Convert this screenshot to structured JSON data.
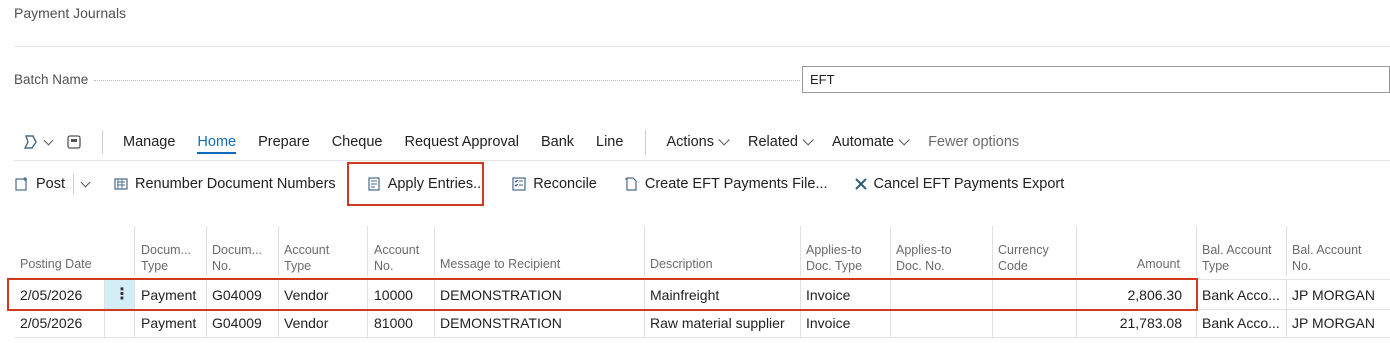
{
  "page": {
    "title": "Payment Journals"
  },
  "batch": {
    "label": "Batch Name",
    "value": "EFT"
  },
  "nav": {
    "tabs": [
      "Manage",
      "Home",
      "Prepare",
      "Cheque",
      "Request Approval",
      "Bank",
      "Line"
    ],
    "active_tab": "Home",
    "menus": [
      "Actions",
      "Related",
      "Automate"
    ],
    "fewer": "Fewer options"
  },
  "actions": {
    "post": "Post",
    "renumber": "Renumber Document Numbers",
    "apply": "Apply Entries...",
    "reconcile": "Reconcile",
    "create_eft": "Create EFT Payments File...",
    "cancel_eft": "Cancel EFT Payments Export"
  },
  "table": {
    "headers": {
      "posting_date": "Posting Date",
      "doc_type_1": "Docum...",
      "doc_type_2": "Type",
      "doc_no_1": "Docum...",
      "doc_no_2": "No.",
      "acc_type_1": "Account",
      "acc_type_2": "Type",
      "acc_no_1": "Account",
      "acc_no_2": "No.",
      "message": "Message to Recipient",
      "description": "Description",
      "applies_type_1": "Applies-to",
      "applies_type_2": "Doc. Type",
      "applies_no_1": "Applies-to",
      "applies_no_2": "Doc. No.",
      "currency_1": "Currency",
      "currency_2": "Code",
      "amount": "Amount",
      "bal_type_1": "Bal. Account",
      "bal_type_2": "Type",
      "bal_no_1": "Bal. Account",
      "bal_no_2": "No."
    },
    "rows": [
      {
        "posting_date": "2/05/2026",
        "doc_type": "Payment",
        "doc_no": "G04009",
        "acc_type": "Vendor",
        "acc_no": "10000",
        "message": "DEMONSTRATION",
        "description": "Mainfreight",
        "applies_type": "Invoice",
        "applies_no": "",
        "currency": "",
        "amount": "2,806.30",
        "bal_type": "Bank Acco...",
        "bal_no": "JP MORGAN"
      },
      {
        "posting_date": "2/05/2026",
        "doc_type": "Payment",
        "doc_no": "G04009",
        "acc_type": "Vendor",
        "acc_no": "81000",
        "message": "DEMONSTRATION",
        "description": "Raw material supplier",
        "applies_type": "Invoice",
        "applies_no": "",
        "currency": "",
        "amount": "21,783.08",
        "bal_type": "Bank Acco...",
        "bal_no": "JP MORGAN"
      }
    ]
  },
  "colors": {
    "accent": "#0f6cbd",
    "highlight": "#d0391f",
    "selected_cell": "#d4eef7"
  },
  "icons": [
    "copilot-icon",
    "chevron-down-icon",
    "pages-icon",
    "post-icon",
    "renumber-icon",
    "apply-entries-icon",
    "reconcile-icon",
    "create-file-icon",
    "cancel-x-icon",
    "row-menu-icon"
  ]
}
